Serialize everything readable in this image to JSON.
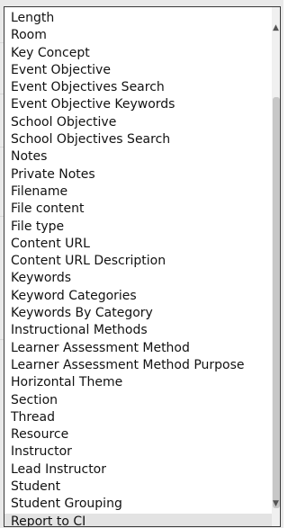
{
  "dropdown": {
    "options": [
      "Length",
      "Room",
      "Key Concept",
      "Event Objective",
      "Event Objectives Search",
      "Event Objective Keywords",
      "School Objective",
      "School Objectives Search",
      "Notes",
      "Private Notes",
      "Filename",
      "File content",
      "File type",
      "Content URL",
      "Content URL Description",
      "Keywords",
      "Keyword Categories",
      "Keywords By Category",
      "Instructional Methods",
      "Learner Assessment Method",
      "Learner Assessment Method Purpose",
      "Horizontal Theme",
      "Section",
      "Thread",
      "Resource",
      "Instructor",
      "Lead Instructor",
      "Student",
      "Student Grouping",
      "Report to CI"
    ],
    "selected_index": 29
  },
  "scrollbar": {
    "up_icon": "chevron-up-icon",
    "down_icon": "chevron-down-icon"
  }
}
